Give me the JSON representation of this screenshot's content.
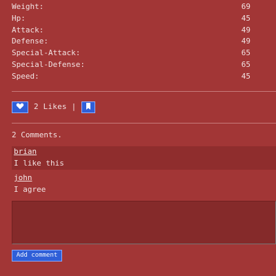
{
  "stats": [
    {
      "label": "Weight:",
      "value": "69"
    },
    {
      "label": "Hp:",
      "value": "45"
    },
    {
      "label": "Attack:",
      "value": "49"
    },
    {
      "label": "Defense:",
      "value": "49"
    },
    {
      "label": "Special-Attack:",
      "value": "65"
    },
    {
      "label": "Special-Defense:",
      "value": "65"
    },
    {
      "label": "Speed:",
      "value": "45"
    }
  ],
  "likes": {
    "text": "2 Likes |",
    "like_icon": "heart-icon",
    "bookmark_icon": "bookmark-icon"
  },
  "comments": {
    "count_text": "2 Comments.",
    "items": [
      {
        "author": "brian",
        "text": "I like this"
      },
      {
        "author": "john",
        "text": "I agree"
      }
    ]
  },
  "comment_form": {
    "value": "",
    "placeholder": "",
    "submit_label": "Add comment"
  },
  "colors": {
    "background": "#a23636",
    "accent": "#2f5fd8",
    "comment_highlight": "#8f2d2d",
    "input_background": "#852a2a"
  }
}
